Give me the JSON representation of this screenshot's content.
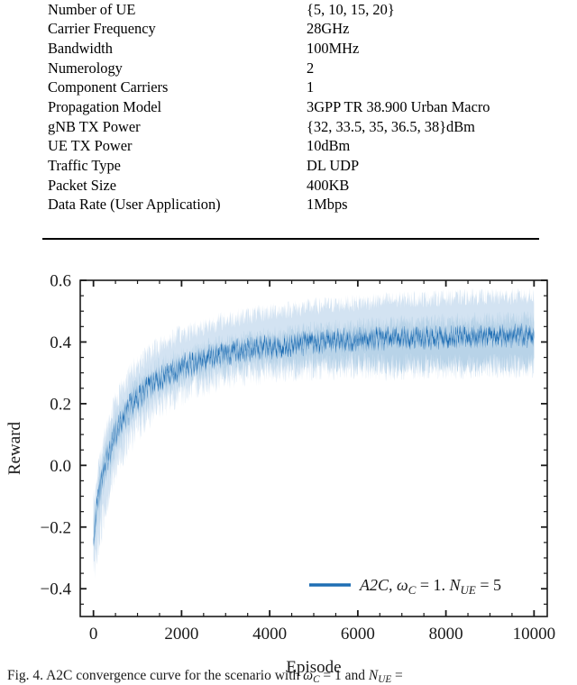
{
  "table": {
    "rows": [
      {
        "key": "Number of UE",
        "value": "{5, 10, 15, 20}"
      },
      {
        "key": "Carrier Frequency",
        "value": "28GHz"
      },
      {
        "key": "Bandwidth",
        "value": "100MHz"
      },
      {
        "key": "Numerology",
        "value": "2"
      },
      {
        "key": "Component Carriers",
        "value": "1"
      },
      {
        "key": "Propagation Model",
        "value": "3GPP TR 38.900 Urban Macro"
      },
      {
        "key": "gNB TX Power",
        "value": "{32, 33.5, 35, 36.5, 38}dBm"
      },
      {
        "key": "UE TX Power",
        "value": "10dBm"
      },
      {
        "key": "Traffic Type",
        "value": "DL UDP"
      },
      {
        "key": "Packet Size",
        "value": "400KB"
      },
      {
        "key": "Data Rate (User Application)",
        "value": "1Mbps"
      }
    ]
  },
  "figure": {
    "caption_prefix": "Fig. 4.",
    "caption_text": "A2C convergence curve for the scenario with",
    "caption_math_1": "ω",
    "caption_math_1_sub": "C",
    "caption_eq_1": "= 1 and",
    "caption_math_2": "N",
    "caption_math_2_sub": "UE",
    "caption_eq_2": "="
  },
  "chart_data": {
    "type": "line",
    "title": "",
    "xlabel": "Episode",
    "ylabel": "Reward",
    "xlim": [
      -300,
      10300
    ],
    "ylim": [
      -0.49,
      0.6
    ],
    "xticks": [
      0,
      2000,
      4000,
      6000,
      8000,
      10000
    ],
    "xticklabels": [
      "0",
      "2000",
      "4000",
      "6000",
      "8000",
      "10000"
    ],
    "yticks": [
      -0.4,
      -0.2,
      0.0,
      0.2,
      0.4,
      0.6
    ],
    "yticklabels": [
      "−0.4",
      "−0.2",
      "0.0",
      "0.2",
      "0.4",
      "0.6"
    ],
    "minor_xtick_step": 500,
    "minor_ytick_step": 0.05,
    "grid": false,
    "legend_position": "lower right",
    "colors": {
      "mean_line": "#1f6eb4",
      "band_inner": "#b8d3e8",
      "band_outer": "#d3e3f2",
      "axis": "#1a1a1a"
    },
    "series": [
      {
        "name": "A2C, ω_C = 1. N_UE = 5",
        "legend_label_plain": "A2C, ω",
        "legend_sub_1": "C",
        "legend_eq_1": "= 1.",
        "legend_math_2": "N",
        "legend_sub_2": "UE",
        "legend_eq_2": "= 5",
        "x": [
          0,
          100,
          200,
          300,
          400,
          500,
          600,
          700,
          800,
          900,
          1000,
          1200,
          1400,
          1600,
          1800,
          2000,
          2400,
          2800,
          3200,
          3600,
          4000,
          4500,
          5000,
          5500,
          6000,
          6500,
          7000,
          7500,
          8000,
          8500,
          9000,
          9500,
          10000
        ],
        "mean": [
          -0.215,
          -0.125,
          -0.045,
          0.015,
          0.06,
          0.1,
          0.133,
          0.16,
          0.183,
          0.203,
          0.22,
          0.249,
          0.272,
          0.29,
          0.305,
          0.318,
          0.339,
          0.355,
          0.368,
          0.378,
          0.386,
          0.394,
          0.4,
          0.405,
          0.409,
          0.412,
          0.414,
          0.416,
          0.417,
          0.419,
          0.42,
          0.421,
          0.422
        ],
        "band_inner_low": [
          -0.255,
          -0.175,
          -0.1,
          -0.04,
          0.008,
          0.05,
          0.085,
          0.113,
          0.137,
          0.158,
          0.176,
          0.206,
          0.23,
          0.248,
          0.263,
          0.276,
          0.297,
          0.311,
          0.32,
          0.326,
          0.33,
          0.333,
          0.335,
          0.336,
          0.337,
          0.328,
          0.33,
          0.331,
          0.331,
          0.332,
          0.332,
          0.333,
          0.333
        ],
        "band_inner_high": [
          -0.175,
          -0.075,
          0.01,
          0.07,
          0.115,
          0.152,
          0.183,
          0.208,
          0.23,
          0.248,
          0.263,
          0.29,
          0.311,
          0.328,
          0.342,
          0.354,
          0.374,
          0.39,
          0.403,
          0.413,
          0.422,
          0.432,
          0.44,
          0.447,
          0.453,
          0.458,
          0.462,
          0.465,
          0.468,
          0.47,
          0.472,
          0.473,
          0.474
        ],
        "band_outer_low": [
          -0.35,
          -0.265,
          -0.18,
          -0.115,
          -0.06,
          -0.015,
          0.022,
          0.053,
          0.08,
          0.103,
          0.123,
          0.157,
          0.184,
          0.205,
          0.222,
          0.237,
          0.262,
          0.28,
          0.292,
          0.3,
          0.306,
          0.311,
          0.314,
          0.316,
          0.318,
          0.312,
          0.314,
          0.316,
          0.317,
          0.318,
          0.319,
          0.32,
          0.32
        ],
        "band_outer_high": [
          -0.13,
          -0.025,
          0.06,
          0.122,
          0.17,
          0.208,
          0.24,
          0.267,
          0.29,
          0.31,
          0.327,
          0.355,
          0.378,
          0.396,
          0.411,
          0.424,
          0.446,
          0.463,
          0.477,
          0.488,
          0.497,
          0.507,
          0.515,
          0.522,
          0.528,
          0.533,
          0.537,
          0.54,
          0.543,
          0.545,
          0.547,
          0.548,
          0.549
        ]
      }
    ]
  }
}
